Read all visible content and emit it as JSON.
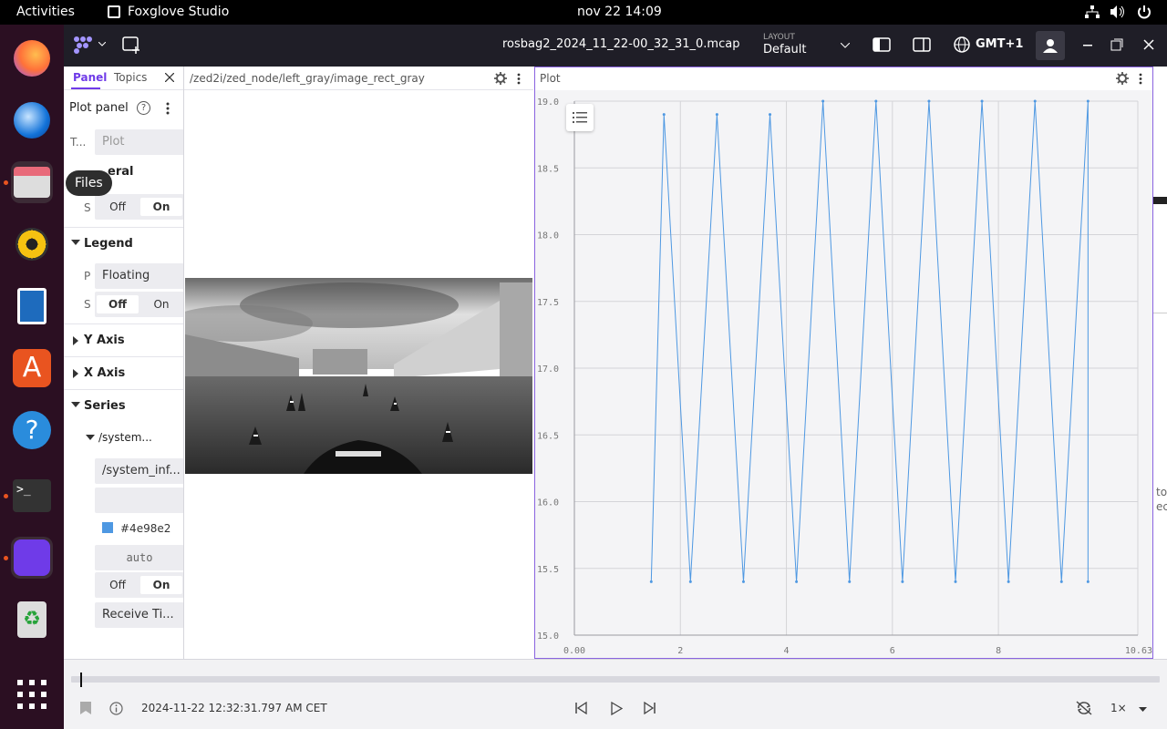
{
  "topbar": {
    "activities": "Activities",
    "app_name": "Foxglove Studio",
    "datetime": "nov 22  14:09"
  },
  "dock": {
    "tooltip": "Files"
  },
  "header": {
    "filename": "rosbag2_2024_11_22-00_32_31_0.mcap",
    "layout_caption": "LAYOUT",
    "layout_value": "Default",
    "timezone": "GMT+1"
  },
  "sidebar": {
    "tabs": [
      "Panel",
      "Topics"
    ],
    "panel_title": "Plot panel",
    "title_label": "T...",
    "title_placeholder": "Plot",
    "general_label": "eral",
    "sync_label": "S",
    "off": "Off",
    "on": "On",
    "legend_label": "Legend",
    "legend_pos_label": "P",
    "legend_pos_value": "Floating",
    "legend_show_label": "S",
    "y_axis": "Y Axis",
    "x_axis": "X Axis",
    "series": "Series",
    "series_item": "/system...",
    "series_path": "/system_inf...",
    "series_color": "#4e98e2",
    "series_width": "auto",
    "series_timestamp": "Receive Ti..."
  },
  "image_panel": {
    "topic": "/zed2i/zed_node/left_gray/image_rect_gray"
  },
  "plot_panel": {
    "title": "Plot"
  },
  "right_edge": {
    "frag1": "to",
    "frag2": "ec"
  },
  "bottom": {
    "timestamp": "2024-11-22 12:32:31.797 AM CET",
    "speed": "1×"
  },
  "chart_data": {
    "type": "line",
    "title": "",
    "xlabel": "",
    "ylabel": "",
    "xlim": [
      0.0,
      10.63
    ],
    "ylim": [
      15.0,
      19.0
    ],
    "xticks": [
      "0.00",
      "2",
      "4",
      "6",
      "8",
      "10.63"
    ],
    "yticks": [
      "15.0",
      "15.5",
      "16.0",
      "16.5",
      "17.0",
      "17.5",
      "18.0",
      "18.5",
      "19.0"
    ],
    "grid": true,
    "series": [
      {
        "color": "#4e98e2",
        "x": [
          1.45,
          1.69,
          2.19,
          2.69,
          3.19,
          3.69,
          4.19,
          4.69,
          5.19,
          5.69,
          6.19,
          6.69,
          7.19,
          7.69,
          8.19,
          8.69,
          9.19,
          9.69,
          9.69
        ],
        "y": [
          15.4,
          18.9,
          15.4,
          18.9,
          15.4,
          18.9,
          15.4,
          19.0,
          15.4,
          19.0,
          15.4,
          19.0,
          15.4,
          19.0,
          15.4,
          19.0,
          15.4,
          19.0,
          15.4
        ]
      }
    ]
  }
}
